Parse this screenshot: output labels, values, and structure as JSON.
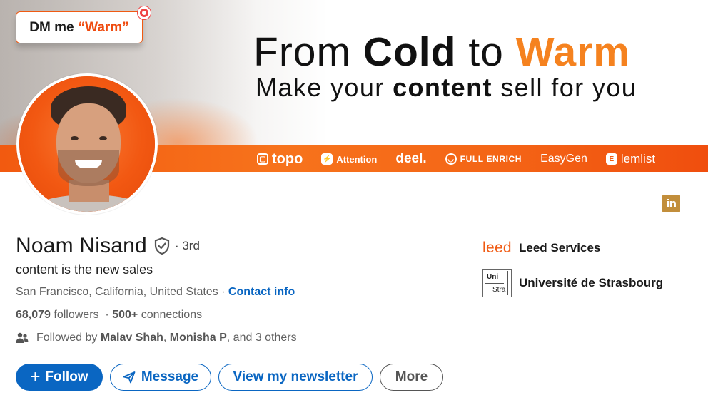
{
  "banner": {
    "dm_prefix": "DM me",
    "dm_keyword": "“Warm”",
    "headline_from": "From",
    "headline_cold": "Cold",
    "headline_to": "to",
    "headline_warm": "Warm",
    "subline_pre": "Make your",
    "subline_bold": "content",
    "subline_post": "sell for you",
    "sponsors": [
      {
        "label": "topo",
        "icon": "topo-icon"
      },
      {
        "label": "Attention",
        "icon": "lightning-icon"
      },
      {
        "label": "deel.",
        "icon": ""
      },
      {
        "label": "FULL ENRICH",
        "icon": "globe-icon"
      },
      {
        "label": "EasyGen",
        "icon": ""
      },
      {
        "label": "lemlist",
        "icon": "lemlist-icon"
      }
    ],
    "accent_color": "#f25a10"
  },
  "profile": {
    "name": "Noam Nisand",
    "verified_icon": "shield-check-icon",
    "degree": "· 3rd",
    "headline": "content is the new sales",
    "location": "San Francisco, California, United States",
    "separator": "·",
    "contact_label": "Contact info",
    "followers_count": "68,079",
    "followers_label": "followers",
    "connections_count": "500+",
    "connections_label": "connections",
    "followed_by_prefix": "Followed by",
    "followed_by_1": "Malav Shah",
    "followed_by_sep": ",",
    "followed_by_2": "Monisha P",
    "followed_by_suffix": ", and 3 others"
  },
  "actions": {
    "follow": "Follow",
    "message": "Message",
    "newsletter": "View my newsletter",
    "more": "More"
  },
  "orgs": {
    "company_logo_text": "leed",
    "company_name": "Leed Services",
    "school_logo_top": "Uni",
    "school_logo_bottom": "Stra",
    "school_name": "Université de Strasbourg"
  },
  "linkedin_badge": "in",
  "colors": {
    "primary": "#0a66c2",
    "orange": "#f5821f",
    "linkedin_badge": "#c28e3b"
  }
}
